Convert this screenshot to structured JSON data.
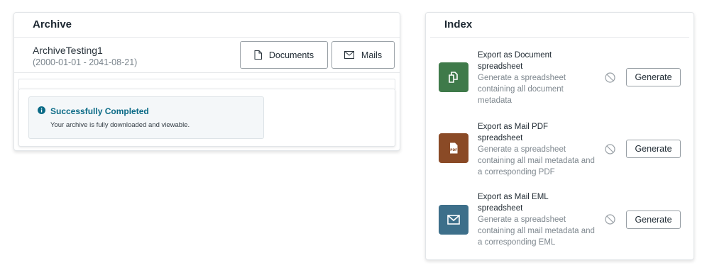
{
  "archive": {
    "title": "Archive",
    "name": "ArchiveTesting1",
    "date_range": "(2000-01-01 - 2041-08-21)",
    "documents_label": "Documents",
    "mails_label": "Mails",
    "status": {
      "title": "Successfully Completed",
      "message": "Your archive is fully downloaded and viewable."
    }
  },
  "index": {
    "title": "Index",
    "exports": [
      {
        "title": "Export as Document spreadsheet",
        "description": "Generate a spreadsheet containing all document metadata",
        "button": "Generate",
        "icon": "documents-icon",
        "color": "#3f7a4a"
      },
      {
        "title": "Export as Mail PDF spreadsheet",
        "description": "Generate a spreadsheet containing all mail metadata and a corresponding PDF",
        "button": "Generate",
        "icon": "pdf-icon",
        "color": "#8a4a26"
      },
      {
        "title": "Export as Mail EML spreadsheet",
        "description": "Generate a spreadsheet containing all mail metadata and a corresponding EML",
        "button": "Generate",
        "icon": "mail-icon",
        "color": "#3d6f8a"
      }
    ]
  }
}
